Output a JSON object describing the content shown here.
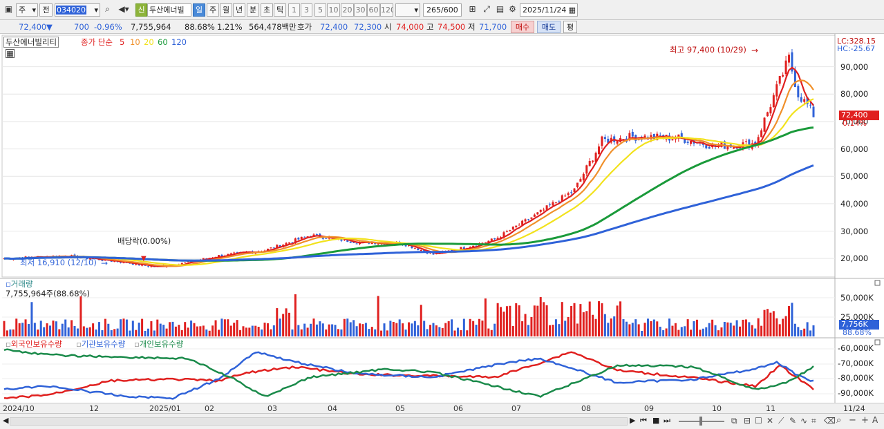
{
  "toolbar": {
    "market": "주",
    "prev": "전",
    "code": "034020",
    "credit_badge": "신",
    "stock_name": "두산에너빌",
    "periods": [
      "일",
      "주",
      "월",
      "년",
      "분",
      "초",
      "틱"
    ],
    "active_period": "일",
    "intervals": [
      "1",
      "3",
      "5",
      "10",
      "20",
      "30",
      "60",
      "120"
    ],
    "count": "265",
    "count_max": "/600",
    "date": "2025/11/24"
  },
  "quote": {
    "price": "72,400",
    "arrow": "▼",
    "change": "700",
    "change_pct": "-0.96%",
    "volume": "7,755,964",
    "volume_ratio": "88.68%",
    "turnover": "1.21%",
    "amount": "564,478백만",
    "hoga_label": "호가",
    "ask": "72,400",
    "bid": "72,300",
    "open_label": "시",
    "open": "74,000",
    "high_label": "고",
    "high": "74,500",
    "low_label": "저",
    "low": "71,700",
    "buy_label": "매수",
    "sell_label": "매도",
    "eval_label": "평"
  },
  "price_panel": {
    "name_tag": "두산에너빌리티",
    "legend_prefix": "종가 단순",
    "ma": [
      {
        "label": "5",
        "color": "#e0201f"
      },
      {
        "label": "10",
        "color": "#f0902a"
      },
      {
        "label": "20",
        "color": "#f2e21d"
      },
      {
        "label": "60",
        "color": "#1a9a3a"
      },
      {
        "label": "120",
        "color": "#2f62d8"
      }
    ],
    "high_marker": "최고 97,400 (10/29)",
    "low_marker": "최저 16,910 (12/10)",
    "dividend_marker": "배당락(0.00%)",
    "lc": "LC:328.15",
    "hc": "HC:-25.67",
    "price_tag": "72,400",
    "pct_tag": "0.14%",
    "y_labels": [
      "90,000",
      "80,000",
      "70,000",
      "60,000",
      "50,000",
      "40,000",
      "30,000",
      "20,000"
    ],
    "y_values": [
      90000,
      80000,
      70000,
      60000,
      50000,
      40000,
      30000,
      20000
    ]
  },
  "volume_panel": {
    "title": "거래량",
    "value": "7,755,964주(88.68%)",
    "y_labels": [
      "50,000K",
      "25,000K"
    ],
    "tag": "7,756K",
    "tag_pct": "88.68%"
  },
  "holding_panel": {
    "series": [
      {
        "label": "외국인보유수량",
        "color": "#e0201f"
      },
      {
        "label": "기관보유수량",
        "color": "#2f62d8"
      },
      {
        "label": "개인보유수량",
        "color": "#1a8a4a"
      }
    ],
    "y_labels": [
      "-60,000K",
      "-70,000K",
      "-80,000K",
      "-90,000K"
    ]
  },
  "x_axis": {
    "ticks": [
      "2024/10",
      "12",
      "2025/01",
      "02",
      "03",
      "04",
      "05",
      "06",
      "07",
      "08",
      "09",
      "10",
      "11"
    ],
    "end_label": "11/24"
  },
  "colors": {
    "up": "#e0201f",
    "down": "#2f62d8",
    "active": "#4a8ad8"
  }
}
